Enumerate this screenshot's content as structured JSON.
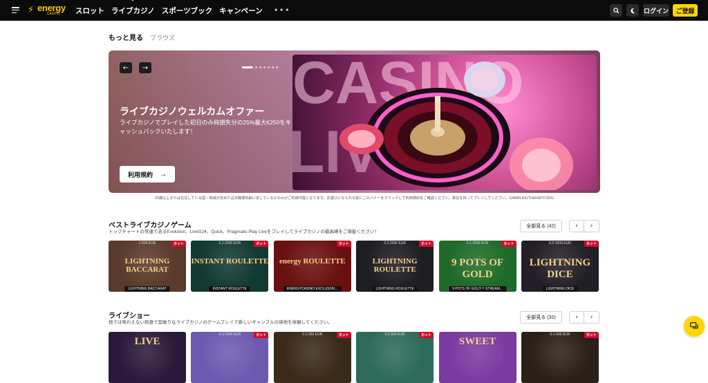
{
  "header": {
    "logo_text": "energy",
    "logo_sub": "casino",
    "nav": [
      "スロット",
      "ライブカジノ",
      "スポーツブック",
      "キャンペーン"
    ],
    "more": "•••",
    "search_icon": "search-icon",
    "theme_icon": "moon-icon",
    "login_label": "ログイン",
    "register_label": "ご登録"
  },
  "breadcrumb": {
    "main": "もっと見る",
    "sub": "ブラウズ"
  },
  "hero": {
    "title": "ライブカジノウェルカムオファー",
    "desc": "ライブカジノでプレイした初日のみ純損失分の25%最大€250をキャッシュバックいたします！",
    "cta": "利用規約",
    "cta_arrow": "→",
    "prev": "←",
    "next": "→",
    "disclaimer": "20歳以上または在住している国・地域が定めた合法賭博年齢に達しているかのみがご利用可能となります。お遊びになられる前にこのバナーをクリックして利用規約をご確認ください。責任を持ってプレイしてください。GAMBLINGTHERAPY.ORG"
  },
  "sections": [
    {
      "title": "ベストライブカジノゲーム",
      "sub": "トップチャートの常連であるEvolution、LiveG24、Quick、Pragmatic Play Liveをプレイしてライブカジノの最高峰をご堪能ください！",
      "see_all": "全部見る (42)",
      "prev": "‹",
      "next": "›",
      "tiles": [
        {
          "limit": "1-500 EUR",
          "badge": "ホット",
          "art": "LIGHTNING BACCARAT",
          "caption": "LIGHTNING BACCARAT",
          "bg": "#5a3a2a"
        },
        {
          "limit": "0.1-2000 EUR",
          "badge": "ホット",
          "art": "INSTANT ROULETTE",
          "caption": "INSTANT ROULETTE",
          "bg": "#123a32"
        },
        {
          "limit": "",
          "badge": "ホット",
          "art": "energy ROULETTE",
          "caption": "ENERGYCASINO EXCLUSIVE...",
          "bg": "#6a1010"
        },
        {
          "limit": "0.2-2000 EUR",
          "badge": "ホット",
          "art": "LIGHTNING ROULETTE",
          "caption": "LIGHTNING ROULETTE",
          "bg": "#1d1d22"
        },
        {
          "limit": "0.1-2000 EUR",
          "badge": "ホット",
          "art": "9 POTS OF GOLD",
          "caption": "9 POTS OF GOLD™ STREAM...",
          "bg": "#1f6a2a"
        },
        {
          "limit": "0.2-1000 EUR",
          "badge": "ホット",
          "art": "LIGHTNING DICE",
          "caption": "LIGHTNING DICE",
          "bg": "#222026"
        }
      ]
    },
    {
      "title": "ライブショー",
      "sub": "他では味わえない刺激で型破りなライブカジノのゲームプレイで新しいギャンブルの境地を体験してください。",
      "see_all": "全部見る (32)",
      "prev": "‹",
      "next": "›",
      "tiles": [
        {
          "limit": "",
          "badge": "",
          "art": "LIVE",
          "caption": "",
          "bg": "#2a1a3a"
        },
        {
          "limit": "0.1-2000 EUR",
          "badge": "ホット",
          "art": "",
          "caption": "",
          "bg": "#6c5ab0"
        },
        {
          "limit": "0.1-250 EUR",
          "badge": "ホット",
          "art": "",
          "caption": "",
          "bg": "#3a2a1a"
        },
        {
          "limit": "0.1-500 EUR",
          "badge": "ホット",
          "art": "",
          "caption": "",
          "bg": "#2d6a5a"
        },
        {
          "limit": "",
          "badge": "",
          "art": "SWEET",
          "caption": "",
          "bg": "#7a3aa0"
        },
        {
          "limit": "0.1-500 EUR",
          "badge": "ホット",
          "art": "",
          "caption": "",
          "bg": "#2a2018"
        }
      ]
    }
  ],
  "chat_icon": "chat-icon"
}
